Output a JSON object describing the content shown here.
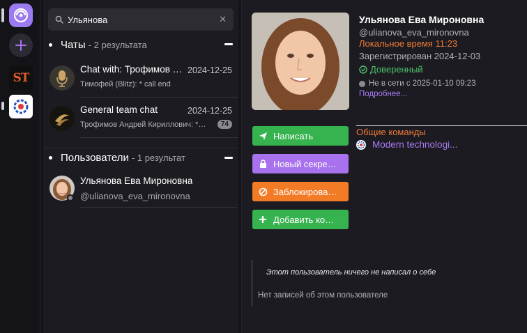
{
  "rail": {
    "items": [
      {
        "icon": "app-logo-icon"
      },
      {
        "icon": "plus-icon"
      },
      {
        "icon": "st-community-icon",
        "text": "ST"
      },
      {
        "icon": "it-community-icon"
      }
    ]
  },
  "search": {
    "value": "Ульянова",
    "clear_icon": "close-icon"
  },
  "chats_section": {
    "title": "Чаты",
    "count": "- 2 результата",
    "items": [
      {
        "name": "Chat with: Трофимов …",
        "date": "2024-12-25",
        "preview": "Тимофей (Blitz): * call end"
      },
      {
        "name": "General team chat",
        "date": "2024-12-25",
        "preview": "Трофимов Андрей Кириллович: *…",
        "badge": "74"
      }
    ]
  },
  "users_section": {
    "title": "Пользователи",
    "count": "- 1 результат",
    "items": [
      {
        "name": "Ульянова Ева Мироновна",
        "handle": "@ulianova_eva_mironovna"
      }
    ]
  },
  "profile": {
    "name": "Ульянова Ева Мироновна",
    "handle": "@ulianova_eva_mironovna",
    "local_time": "Локальное время 11:23",
    "registered": "Зарегистрирован 2024-12-03",
    "trusted": "Доверенный",
    "last_seen": "Не в сети с 2025-01-10 09:23",
    "more_link": "Подробнее...",
    "actions": {
      "write": "Написать",
      "secret": "Новый секре…",
      "block": "Заблокирова…",
      "add": "Добавить ко…"
    },
    "common": {
      "title": "Общие команды",
      "items": [
        {
          "name": "Modern technologi..."
        }
      ]
    },
    "about": "Этот пользователь ничего не написал о себе",
    "no_records": "Нет записей об этом пользователе"
  },
  "colors": {
    "accent_purple": "#a872ee",
    "accent_green": "#36b34e",
    "accent_orange": "#f47b25",
    "link_purple": "#a97bf3",
    "trusted_green": "#4cc36a"
  }
}
